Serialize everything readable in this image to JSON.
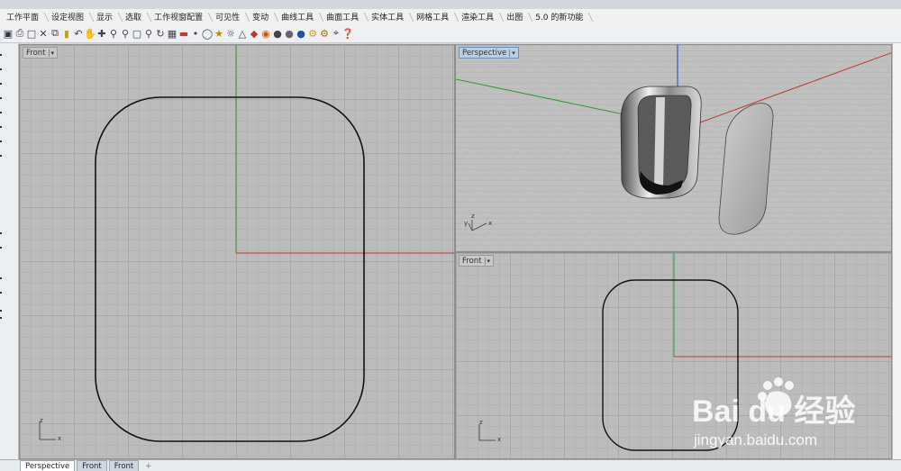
{
  "menu_tabs": [
    "工作平面",
    "设定视图",
    "显示",
    "选取",
    "工作视窗配置",
    "可见性",
    "变动",
    "曲线工具",
    "曲面工具",
    "实体工具",
    "网格工具",
    "渲染工具",
    "出图",
    "5.0 的新功能"
  ],
  "toolbar_icons": [
    "save-icon",
    "print-icon",
    "copy-page-icon",
    "cut-icon",
    "copy-icon",
    "paste-icon",
    "undo-icon",
    "pan-icon",
    "move-icon",
    "zoom-icon",
    "zoom-window-icon",
    "zoom-extents-icon",
    "zoom-selected-icon",
    "rotate-view-icon",
    "viewport-layout-icon",
    "car-icon",
    "point-icon",
    "circle-icon",
    "select-icon",
    "light-icon",
    "lock-icon",
    "render-icon",
    "color-wheel-icon",
    "sphere-icon",
    "sphere-shaded-icon",
    "material-icon",
    "settings-icon",
    "gear-group-icon",
    "curve-icon",
    "help-icon"
  ],
  "viewports": {
    "front_large": {
      "label": "Front",
      "axis_z": "z",
      "axis_x": "x"
    },
    "perspective": {
      "label": "Perspective",
      "axis_z": "z",
      "axis_y": "y",
      "axis_x": "x"
    },
    "front_small": {
      "label": "Front",
      "axis_z": "z",
      "axis_x": "x"
    }
  },
  "bottom_tabs": [
    "Perspective",
    "Front",
    "Front"
  ],
  "bottom_add": "+",
  "watermark": {
    "brand": "Bai du 经验",
    "url": "jingyan.baidu.com"
  },
  "colors": {
    "x_axis": "#c0392b",
    "y_axis": "#2e9a2e",
    "z_axis": "#2b3bd0",
    "curve": "#111111"
  }
}
